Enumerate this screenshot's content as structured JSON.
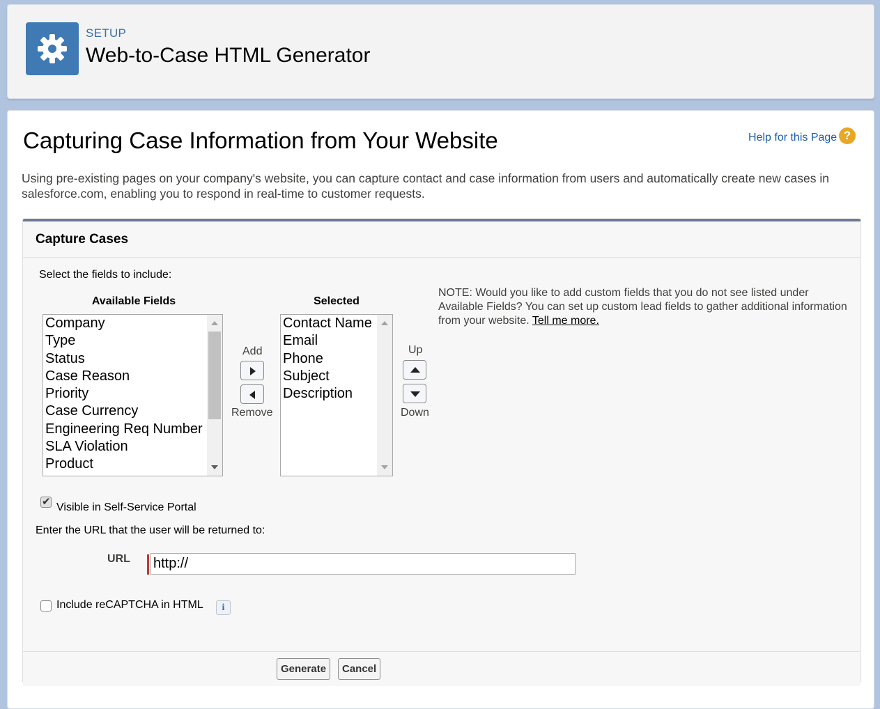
{
  "header": {
    "eyebrow": "SETUP",
    "title": "Web-to-Case HTML Generator"
  },
  "page": {
    "heading": "Capturing Case Information from Your Website",
    "help_link": "Help for this Page",
    "help_icon_glyph": "?",
    "intro": "Using pre-existing pages on your company's website, you can capture contact and case information from users and automatically create new cases in salesforce.com, enabling you to respond in real-time to customer requests."
  },
  "panel": {
    "title": "Capture Cases",
    "select_label": "Select the fields to include:",
    "available_label": "Available Fields",
    "selected_label": "Selected",
    "available_fields": [
      "Company",
      "Type",
      "Status",
      "Case Reason",
      "Priority",
      "Case Currency",
      "Engineering Req Number",
      "SLA Violation",
      "Product"
    ],
    "selected_fields": [
      "Contact Name",
      "Email",
      "Phone",
      "Subject",
      "Description"
    ],
    "add_label": "Add",
    "remove_label": "Remove",
    "up_label": "Up",
    "down_label": "Down",
    "note_text": "NOTE: Would you like to add custom fields that you do not see listed under Available Fields? You can set up custom lead fields to gather additional information from your website.",
    "note_link": "Tell me more.",
    "self_service_label": "Visible in Self-Service Portal",
    "self_service_checked": true,
    "return_url_prompt": "Enter the URL that the user will be returned to:",
    "url_label": "URL",
    "url_value": "http://",
    "recaptcha_label": "Include reCAPTCHA in HTML",
    "recaptcha_checked": false,
    "info_glyph": "i",
    "generate_label": "Generate",
    "cancel_label": "Cancel"
  },
  "colors": {
    "background": "#b0c4df",
    "setup_icon": "#3f7ab5",
    "link": "#1a5ea8",
    "help_icon": "#e8a825",
    "required": "#c23934"
  },
  "icons": {
    "setup": "gear-icon",
    "help": "help-icon",
    "info": "info-icon"
  }
}
